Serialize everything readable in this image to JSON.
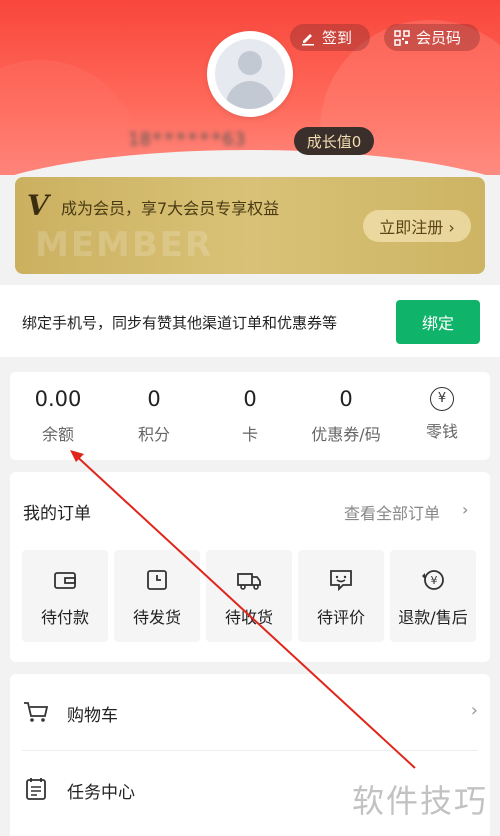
{
  "header": {
    "signin_label": "签到",
    "membercode_label": "会员码",
    "username": "18******63",
    "growth_label": "成长值0"
  },
  "member_card": {
    "logo": "V",
    "title": "成为会员，享7大会员专享权益",
    "watermark": "MEMBER",
    "register_label": "立即注册 ›"
  },
  "bind": {
    "text": "绑定手机号，同步有赞其他渠道订单和优惠券等",
    "button_label": "绑定"
  },
  "assets": [
    {
      "value": "0.00",
      "label": "余额"
    },
    {
      "value": "0",
      "label": "积分"
    },
    {
      "value": "0",
      "label": "卡"
    },
    {
      "value": "0",
      "label": "优惠券/码"
    },
    {
      "icon": "yen-icon",
      "symbol": "¥",
      "label": "零钱"
    }
  ],
  "orders": {
    "title": "我的订单",
    "view_all": "查看全部订单",
    "view_all_chevron": "›",
    "items": [
      {
        "label": "待付款",
        "icon": "wallet-icon"
      },
      {
        "label": "待发货",
        "icon": "box-clock-icon"
      },
      {
        "label": "待收货",
        "icon": "truck-icon"
      },
      {
        "label": "待评价",
        "icon": "smile-chat-icon"
      },
      {
        "label": "退款/售后",
        "icon": "refund-icon"
      }
    ]
  },
  "menu": [
    {
      "label": "购物车",
      "icon": "cart-icon",
      "chevron": "›"
    },
    {
      "label": "任务中心",
      "icon": "task-icon"
    }
  ],
  "watermark_text": "软件技巧",
  "colors": {
    "header_red": "#f9463c",
    "bind_green": "#10b36a",
    "member_gold": "#d9c277",
    "annotation_red": "#e0261c"
  }
}
